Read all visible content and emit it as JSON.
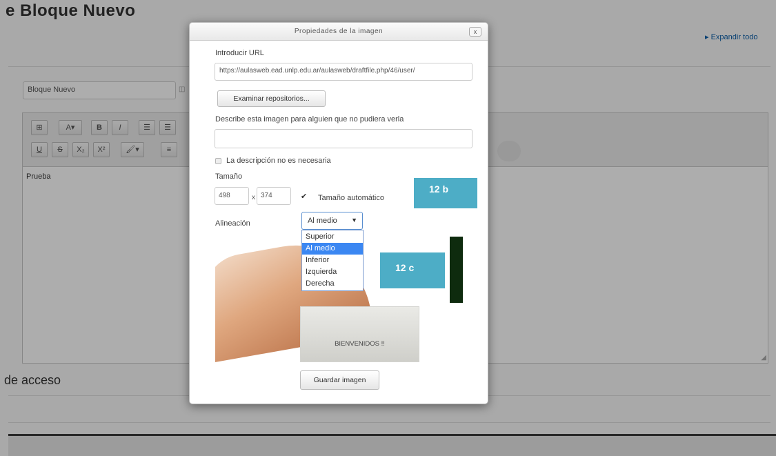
{
  "page": {
    "title": "e Bloque Nuevo",
    "expand_all": "▸ Expandir todo",
    "block_name_value": "Bloque Nuevo",
    "editor_content": "Prueba",
    "access_section_title": "de acceso",
    "toolbar": {
      "row1": [
        "⊞",
        "A▾",
        "B",
        "I",
        "☰",
        "☰"
      ],
      "row2": [
        "U",
        "S",
        "X₂",
        "X²",
        "🖌▾",
        "≡"
      ]
    }
  },
  "dialog": {
    "title": "Propiedades de la imagen",
    "close_label": "x",
    "url_label": "Introducir URL",
    "url_value": "https://aulasweb.ead.unlp.edu.ar/aulasweb/draftfile.php/46/user/",
    "browse_button": "Examinar repositorios...",
    "desc_label": "Describe esta imagen para alguien que no pudiera verla",
    "desc_value": "",
    "no_desc_label": "La descripción no es necesaria",
    "size_label": "Tamaño",
    "width_value": "498",
    "size_separator": "x",
    "height_value": "374",
    "auto_size_label": "Tamaño automático",
    "align_label": "Alineación",
    "align_selected": "Al medio",
    "align_options": [
      "Superior",
      "Al medio",
      "Inferior",
      "Izquierda",
      "Derecha"
    ],
    "preview_text": "BIENVENIDOS !!",
    "save_button": "Guardar imagen"
  },
  "annotations": {
    "callout_b": "12 b",
    "callout_c": "12 c",
    "color": "#4dadc6"
  }
}
